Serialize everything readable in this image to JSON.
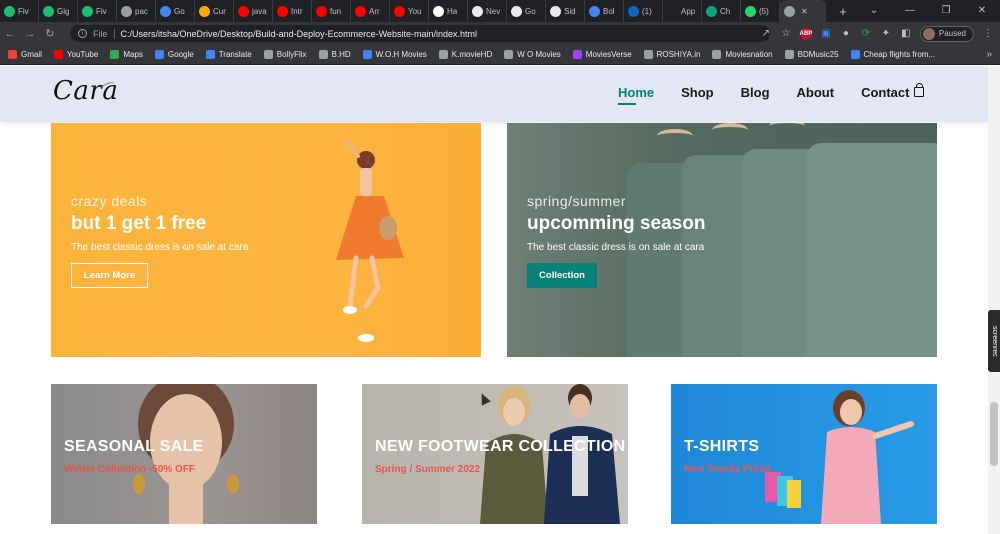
{
  "browser": {
    "tabs": [
      {
        "label": "Fiv",
        "icon": "fiverr-icon",
        "color": "#1dbf73"
      },
      {
        "label": "Gig",
        "icon": "fiverr-icon",
        "color": "#1dbf73"
      },
      {
        "label": "Fiv",
        "icon": "fiverr-icon",
        "color": "#1dbf73"
      },
      {
        "label": "pac",
        "icon": "globe-icon",
        "color": "#9aa0a6"
      },
      {
        "label": "Go",
        "icon": "doc-icon",
        "color": "#4285f4"
      },
      {
        "label": "Cur",
        "icon": "square-icon",
        "color": "#f9ab00"
      },
      {
        "label": "java",
        "icon": "youtube-icon",
        "color": "#ff0000"
      },
      {
        "label": "Intr",
        "icon": "youtube-icon",
        "color": "#ff0000"
      },
      {
        "label": "fun",
        "icon": "youtube-icon",
        "color": "#ff0000"
      },
      {
        "label": "Arr",
        "icon": "youtube-icon",
        "color": "#ff0000"
      },
      {
        "label": "You",
        "icon": "youtube-icon",
        "color": "#ff0000"
      },
      {
        "label": "Ha",
        "icon": "google-icon",
        "color": "#ffffff"
      },
      {
        "label": "Nev",
        "icon": "page-icon",
        "color": "#e8eaed"
      },
      {
        "label": "Go",
        "icon": "page-icon",
        "color": "#e8eaed"
      },
      {
        "label": "Sid",
        "icon": "page-icon",
        "color": "#e8eaed"
      },
      {
        "label": "Bol",
        "icon": "bookmark-icon",
        "color": "#4285f4"
      },
      {
        "label": "(1)",
        "icon": "linkedin-icon",
        "color": "#0a66c2"
      },
      {
        "label": "App",
        "icon": "seven-icon",
        "color": "#202124"
      },
      {
        "label": "Ch",
        "icon": "chatgpt-icon",
        "color": "#10a37f"
      },
      {
        "label": "(5)",
        "icon": "whatsapp-icon",
        "color": "#25d366"
      },
      {
        "label": "",
        "icon": "globe-icon",
        "color": "#9aa0a6",
        "active": true
      }
    ],
    "new_tab": "+",
    "file_label": "File",
    "url": "C:/Users/itsha/OneDrive/Desktop/Build-and-Deploy-Ecommerce-Website-main/index.html",
    "profile_status": "Paused",
    "bookmarks": [
      {
        "label": "Gmail",
        "color": "#ea4335"
      },
      {
        "label": "YouTube",
        "color": "#ff0000"
      },
      {
        "label": "Maps",
        "color": "#34a853"
      },
      {
        "label": "Google",
        "color": "#4285f4"
      },
      {
        "label": "Translate",
        "color": "#4285f4"
      },
      {
        "label": "BollyFlix",
        "color": "#9aa0a6"
      },
      {
        "label": "B.HD",
        "color": "#9aa0a6"
      },
      {
        "label": "W.O.H Movies",
        "color": "#4285f4"
      },
      {
        "label": "K.movieHD",
        "color": "#9aa0a6"
      },
      {
        "label": "W O Movies",
        "color": "#9aa0a6"
      },
      {
        "label": "MoviesVerse",
        "color": "#a142f4"
      },
      {
        "label": "ROSHIYA.in",
        "color": "#9aa0a6"
      },
      {
        "label": "Moviesnation",
        "color": "#9aa0a6"
      },
      {
        "label": "BDMusic25",
        "color": "#9aa0a6"
      },
      {
        "label": "Cheap flights from...",
        "color": "#4285f4"
      }
    ],
    "bookmarks_more": "»"
  },
  "site": {
    "logo": "Cara",
    "nav": [
      {
        "label": "Home",
        "active": true
      },
      {
        "label": "Shop"
      },
      {
        "label": "Blog"
      },
      {
        "label": "About"
      },
      {
        "label": "Contact"
      }
    ],
    "accent_color": "#088178"
  },
  "banners_big": [
    {
      "subtitle": "crazy deals",
      "title": "but 1 get 1 free",
      "description": "The best classic dress is on sale at cara",
      "button": "Learn More"
    },
    {
      "subtitle": "spring/summer",
      "title": "upcomming season",
      "description": "The best classic dress is on sale at cara",
      "button": "Collection"
    }
  ],
  "banners_small": [
    {
      "title": "SEASONAL SALE",
      "subtitle": "Winter Collection -50% OFF"
    },
    {
      "title": "NEW FOOTWEAR COLLECTION",
      "subtitle": "Spring / Summer 2022"
    },
    {
      "title": "T-SHIRTS",
      "subtitle": "New Trendy Prints"
    }
  ],
  "overlay": {
    "screenrec_label": "screenrec"
  }
}
